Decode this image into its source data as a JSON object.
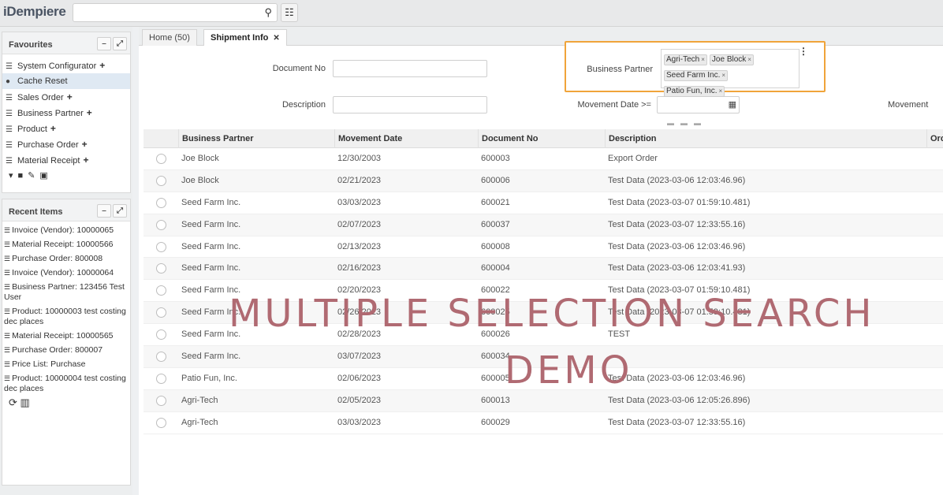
{
  "app": {
    "logo": "iDempiere",
    "search_icon": "search-icon",
    "tree_icon": "sitemap-icon"
  },
  "favourites": {
    "title": "Favourites",
    "items": [
      {
        "label": "System Configurator",
        "plus": true
      },
      {
        "label": "Cache Reset",
        "plus": false,
        "selected": true
      },
      {
        "label": "Sales Order",
        "plus": true
      },
      {
        "label": "Business Partner",
        "plus": true
      },
      {
        "label": "Product",
        "plus": true
      },
      {
        "label": "Purchase Order",
        "plus": true
      },
      {
        "label": "Material Receipt",
        "plus": true
      }
    ]
  },
  "recent": {
    "title": "Recent Items",
    "items": [
      "Invoice (Vendor): 10000065",
      "Material Receipt: 10000566",
      "Purchase Order: 800008",
      "Invoice (Vendor): 10000064",
      "Business Partner: 123456 Test User",
      "Product: 10000003 test costing dec places",
      "Material Receipt: 10000565",
      "Purchase Order: 800007",
      "Price List: Purchase",
      "Product: 10000004 test costing dec places"
    ]
  },
  "tabs": [
    {
      "label": "Home (50)"
    },
    {
      "label": "Shipment Info",
      "close": "✕"
    }
  ],
  "form": {
    "document_no_label": "Document No",
    "description_label": "Description",
    "business_partner_label": "Business Partner",
    "movement_date_label": "Movement Date >=",
    "movement_label_cut": "Movement",
    "selected_partners": [
      "Agri-Tech",
      "Joe Block",
      "Seed Farm Inc.",
      "Patio Fun, Inc."
    ]
  },
  "grid": {
    "columns": [
      "Business Partner",
      "Movement Date",
      "Document No",
      "Description",
      "Orc"
    ],
    "rows": [
      [
        "Joe Block",
        "12/30/2003",
        "600003",
        "Export Order"
      ],
      [
        "Joe Block",
        "02/21/2023",
        "600006",
        "Test Data (2023-03-06 12:03:46.96)"
      ],
      [
        "Seed Farm Inc.",
        "03/03/2023",
        "600021",
        "Test Data (2023-03-07 01:59:10.481)"
      ],
      [
        "Seed Farm Inc.",
        "02/07/2023",
        "600037",
        "Test Data (2023-03-07 12:33:55.16)"
      ],
      [
        "Seed Farm Inc.",
        "02/13/2023",
        "600008",
        "Test Data (2023-03-06 12:03:46.96)"
      ],
      [
        "Seed Farm Inc.",
        "02/16/2023",
        "600004",
        "Test Data (2023-03-06 12:03:41.93)"
      ],
      [
        "Seed Farm Inc.",
        "02/20/2023",
        "600022",
        "Test Data (2023-03-07 01:59:10.481)"
      ],
      [
        "Seed Farm Inc.",
        "02/26/2023",
        "600025",
        "Test Data (2023-03-07 01:59:10.481)"
      ],
      [
        "Seed Farm Inc.",
        "02/28/2023",
        "600026",
        "TEST"
      ],
      [
        "Seed Farm Inc.",
        "03/07/2023",
        "600034",
        ""
      ],
      [
        "Patio Fun, Inc.",
        "02/06/2023",
        "600005",
        "Test Data (2023-03-06 12:03:46.96)"
      ],
      [
        "Agri-Tech",
        "02/05/2023",
        "600013",
        "Test Data (2023-03-06 12:05:26.896)"
      ],
      [
        "Agri-Tech",
        "03/03/2023",
        "600029",
        "Test Data (2023-03-07 12:33:55.16)"
      ]
    ]
  },
  "overlay": {
    "line1": "MULTIPLE SELECTION SEARCH",
    "line2": "DEMO",
    "color": "#b06a72"
  }
}
